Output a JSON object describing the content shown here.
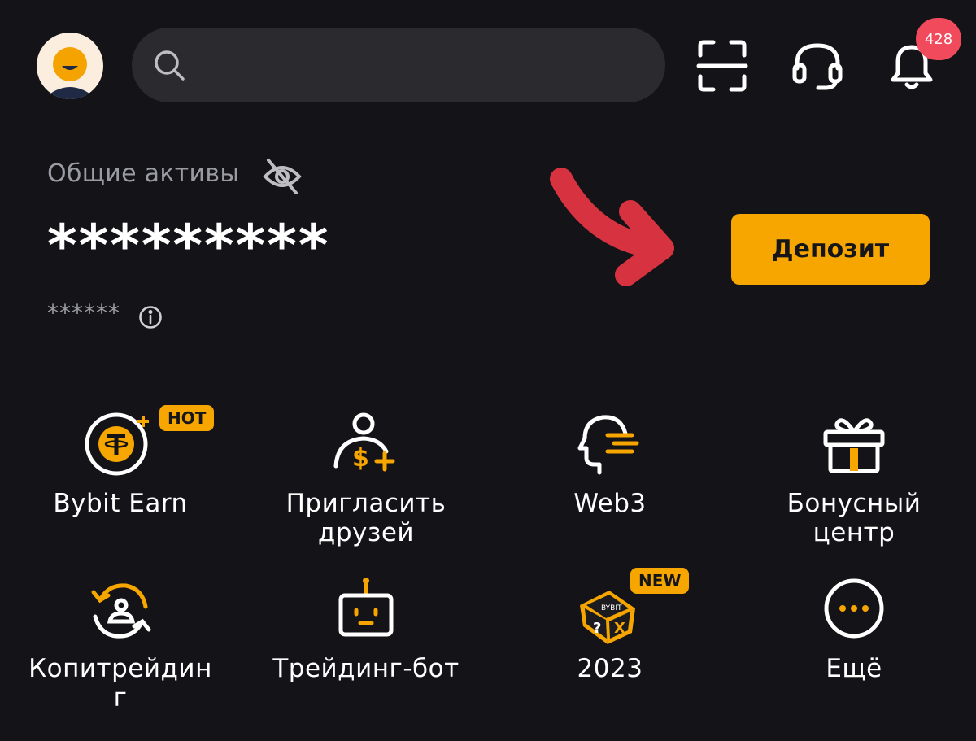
{
  "header": {
    "search": {
      "placeholder": ""
    },
    "notifications_count": "428"
  },
  "assets": {
    "label": "Общие активы",
    "balance": "*********",
    "sub_balance": "******",
    "deposit_label": "Депозит"
  },
  "tiles": [
    {
      "label": "Bybit Earn",
      "icon": "tether-coin-icon",
      "tag": "HOT"
    },
    {
      "label": "Пригласить друзей",
      "icon": "invite-friends-icon"
    },
    {
      "label": "Web3",
      "icon": "web3-head-icon"
    },
    {
      "label": "Бонусный центр",
      "icon": "gift-icon"
    },
    {
      "label": "Копитрейдинг",
      "icon": "copy-trading-icon"
    },
    {
      "label": "Трейдинг-бот",
      "icon": "robot-icon"
    },
    {
      "label": "2023",
      "icon": "bybit-cube-icon",
      "tag": "NEW"
    },
    {
      "label": "Ещё",
      "icon": "more-icon"
    }
  ],
  "colors": {
    "accent": "#f7a600",
    "background": "#131318",
    "badge": "#f04a5c",
    "annotation_arrow": "#d7323f"
  }
}
